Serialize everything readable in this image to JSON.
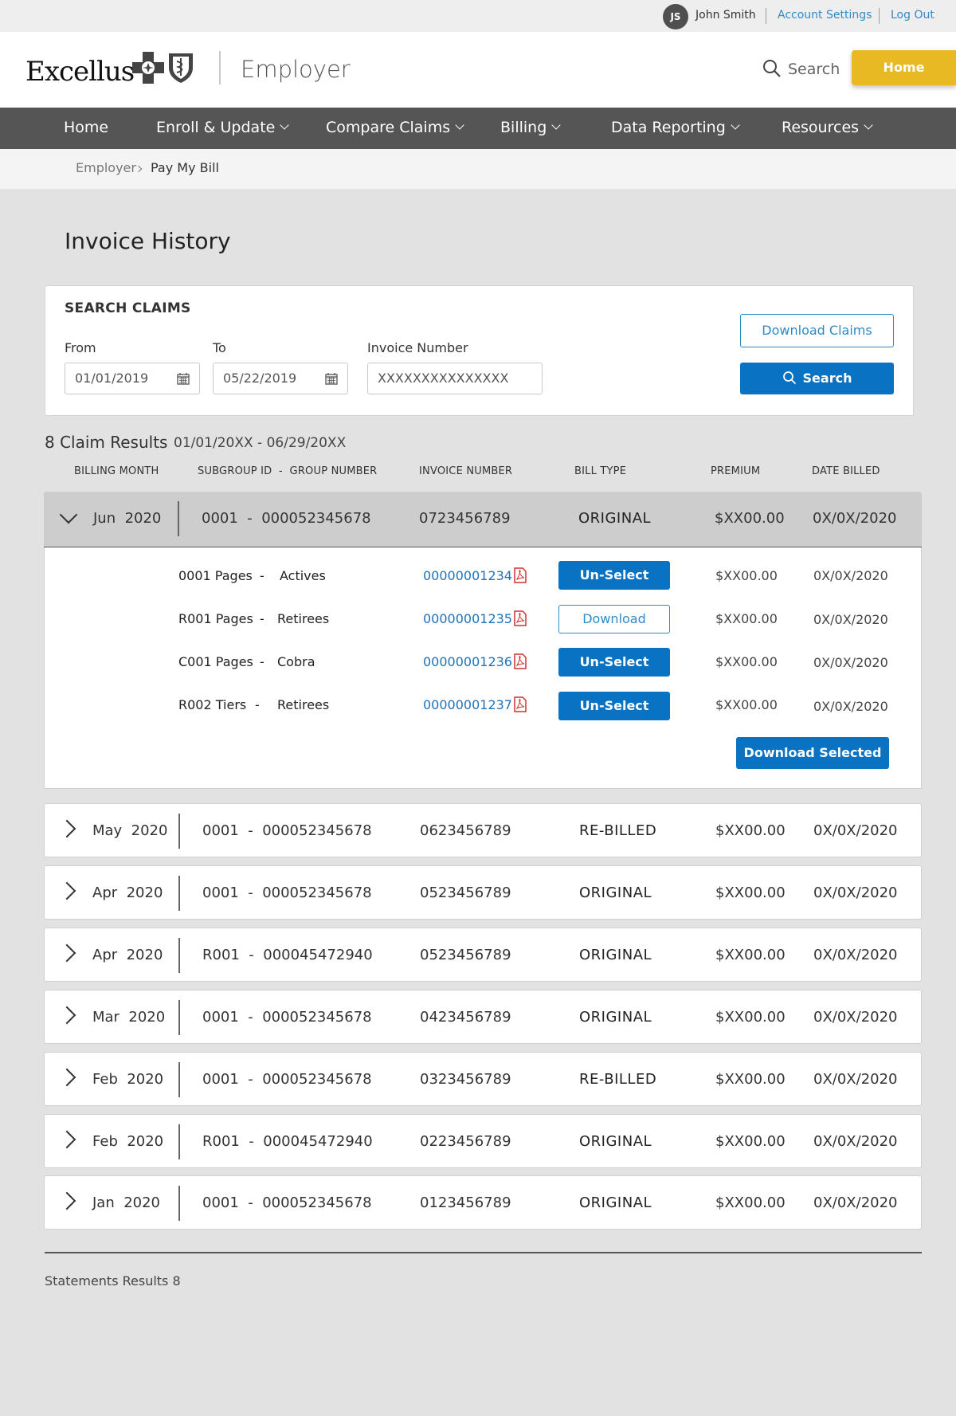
{
  "util": {
    "avatar_initials": "JS",
    "user_name": "John Smith",
    "account_settings": "Account Settings",
    "logout": "Log Out"
  },
  "header": {
    "logo_text": "Excellus",
    "portal_name": "Employer",
    "search_label": "Search",
    "home_button": "Home",
    "accent_color": "#e8b923"
  },
  "nav": {
    "items": [
      {
        "label": "Home"
      },
      {
        "label": "Enroll & Update"
      },
      {
        "label": "Compare Claims"
      },
      {
        "label": "Billing"
      },
      {
        "label": "Data Reporting"
      },
      {
        "label": "Resources"
      }
    ]
  },
  "breadcrumb": {
    "parent": "Employer",
    "current": "Pay My Bill"
  },
  "page": {
    "title": "Invoice History"
  },
  "search": {
    "title": "SEARCH CLAIMS",
    "from_label": "From",
    "from_value": "01/01/2019",
    "to_label": "To",
    "to_value": "05/22/2019",
    "invoice_label": "Invoice Number",
    "invoice_value": "XXXXXXXXXXXXXXX",
    "download_claims": "Download Claims",
    "search_button": "Search",
    "primary_color": "#0a72c2"
  },
  "results": {
    "count_label": "8 Claim Results",
    "range": "01/01/20XX - 06/29/20XX",
    "columns": {
      "billing_month": "BILLING MONTH",
      "subgroup": "SUBGROUP ID  -  GROUP NUMBER",
      "invoice": "INVOICE NUMBER",
      "bill_type": "BILL TYPE",
      "premium": "PREMIUM",
      "date_billed": "DATE BILLED"
    },
    "expanded": {
      "month": "Jun  2020",
      "group": "0001  -  000052345678",
      "invoice": "0723456789",
      "bill_type": "ORIGINAL",
      "premium": "$XX00.00",
      "date_billed": "0X/0X/2020",
      "sub_rows": [
        {
          "code": "0001 Pages",
          "dash": "-",
          "type": "Actives",
          "invoice": "00000001234",
          "action": "Un-Select",
          "premium": "$XX00.00",
          "date": "0X/0X/2020"
        },
        {
          "code": "R001 Pages",
          "dash": "-",
          "type": "Retirees",
          "invoice": "00000001235",
          "action": "Download",
          "premium": "$XX00.00",
          "date": "0X/0X/2020"
        },
        {
          "code": "C001 Pages",
          "dash": "-",
          "type": "Cobra",
          "invoice": "00000001236",
          "action": "Un-Select",
          "premium": "$XX00.00",
          "date": "0X/0X/2020"
        },
        {
          "code": "R002 Tiers",
          "dash": "-",
          "type": "Retirees",
          "invoice": "00000001237",
          "action": "Un-Select",
          "premium": "$XX00.00",
          "date": "0X/0X/2020"
        }
      ],
      "download_selected": "Download Selected"
    },
    "rows": [
      {
        "month": "May  2020",
        "group": "0001  -  000052345678",
        "invoice": "0623456789",
        "bill_type": "RE-BILLED",
        "premium": "$XX00.00",
        "date_billed": "0X/0X/2020"
      },
      {
        "month": "Apr  2020",
        "group": "0001  -  000052345678",
        "invoice": "0523456789",
        "bill_type": "ORIGINAL",
        "premium": "$XX00.00",
        "date_billed": "0X/0X/2020"
      },
      {
        "month": "Apr  2020",
        "group": "R001  -  000045472940",
        "invoice": "0523456789",
        "bill_type": "ORIGINAL",
        "premium": "$XX00.00",
        "date_billed": "0X/0X/2020"
      },
      {
        "month": "Mar  2020",
        "group": "0001  -  000052345678",
        "invoice": "0423456789",
        "bill_type": "ORIGINAL",
        "premium": "$XX00.00",
        "date_billed": "0X/0X/2020"
      },
      {
        "month": "Feb  2020",
        "group": "0001  -  000052345678",
        "invoice": "0323456789",
        "bill_type": "RE-BILLED",
        "premium": "$XX00.00",
        "date_billed": "0X/0X/2020"
      },
      {
        "month": "Feb  2020",
        "group": "R001  -  000045472940",
        "invoice": "0223456789",
        "bill_type": "ORIGINAL",
        "premium": "$XX00.00",
        "date_billed": "0X/0X/2020"
      },
      {
        "month": "Jan  2020",
        "group": "0001  -  000052345678",
        "invoice": "0123456789",
        "bill_type": "ORIGINAL",
        "premium": "$XX00.00",
        "date_billed": "0X/0X/2020"
      }
    ],
    "statements_label": "Statements Results 8"
  }
}
